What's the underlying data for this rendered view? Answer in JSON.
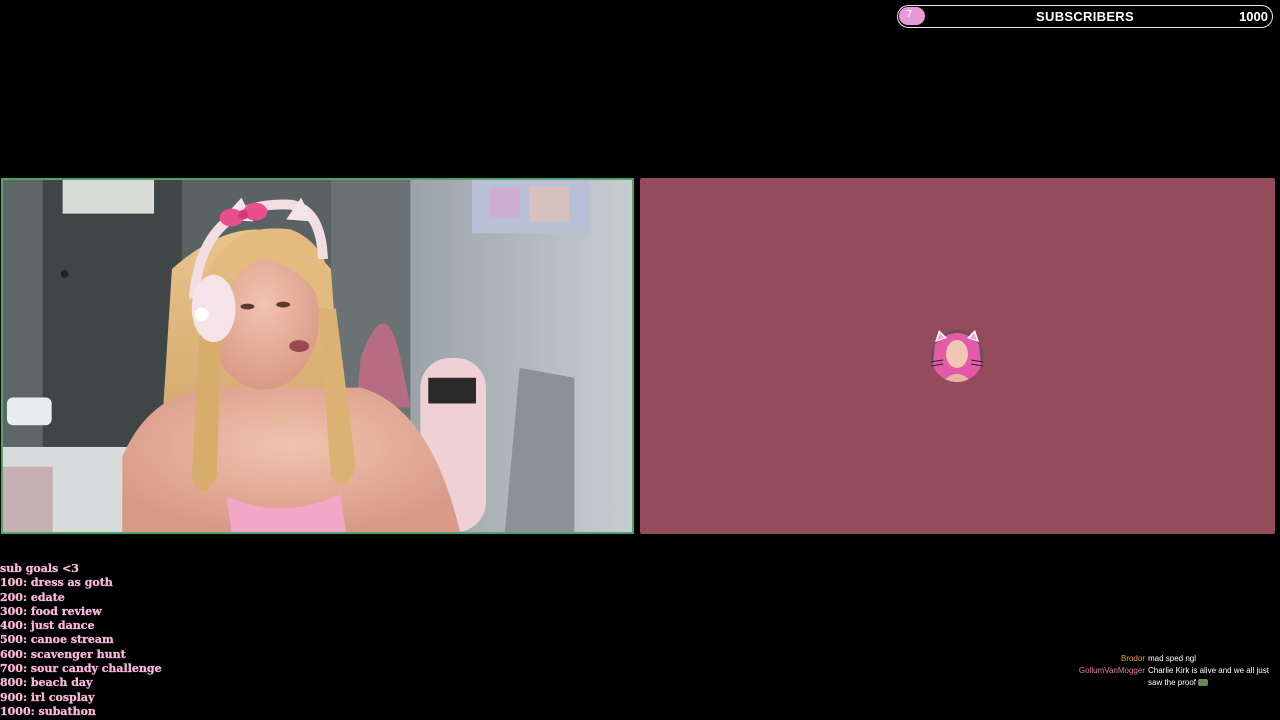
{
  "sub_goal_bar": {
    "current": "7",
    "label": "SUBSCRIBERS",
    "goal": "1000",
    "progress_fraction": 0.007,
    "fill_color": "#e79ad6"
  },
  "goals": {
    "title": "sub goals <3",
    "items": [
      "100: dress as goth",
      "200: edate",
      "300: food review",
      "400: just dance",
      "500: canoe stream",
      "600: scavenger hunt",
      "700: sour candy challenge",
      "800: beach day",
      "900: irl cosplay",
      "1000: subathon"
    ],
    "text_color": "#f7b6da"
  },
  "chat": {
    "messages": [
      {
        "user": "Brodor",
        "user_color": "#e8a23a",
        "text": "mad sped ngl",
        "emote": ""
      },
      {
        "user": "GollumVanMogger",
        "user_color": "#e57aa6",
        "text": "Charlie Kirk is alive and we all just saw the proof",
        "emote": "emote-icon"
      }
    ]
  },
  "colors": {
    "background": "#000000",
    "cam_border": "#4fa56d",
    "call_panel": "#944c5d"
  }
}
